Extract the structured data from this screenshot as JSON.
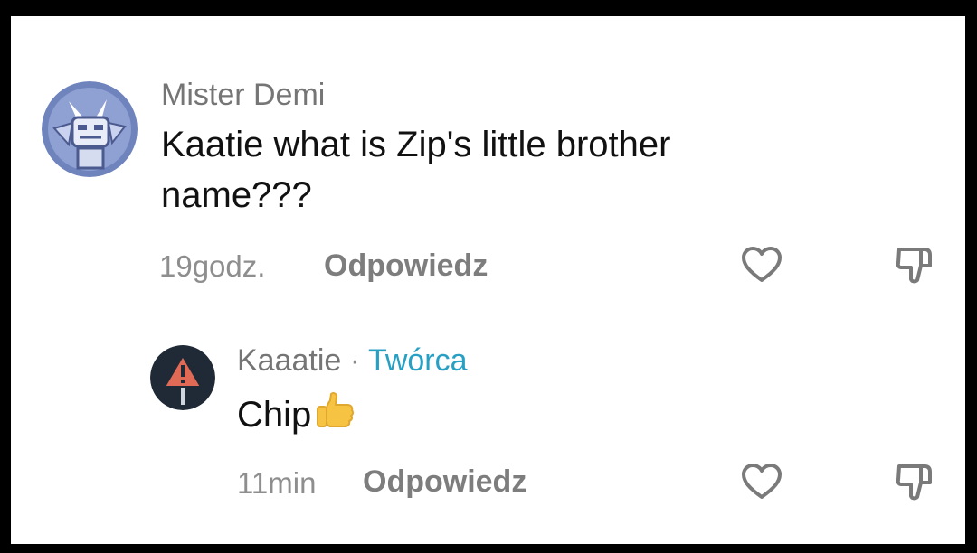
{
  "comments": [
    {
      "username": "Mister Demi",
      "text": "Kaatie what is Zip's little brother name???",
      "time": "19godz.",
      "reply_label": "Odpowiedz",
      "avatar_icon": "robot-character-avatar"
    }
  ],
  "reply": {
    "username": "Kaaatie",
    "separator": "·",
    "creator_label": "Twórca",
    "text": "Chip",
    "emoji_icon": "thumbs-up-emoji",
    "time": "11min",
    "reply_label": "Odpowiedz",
    "avatar_icon": "warning-sign-avatar"
  },
  "colors": {
    "creator_accent": "#27a0c4",
    "frame_border": "#000000",
    "background": "#ffffff"
  }
}
